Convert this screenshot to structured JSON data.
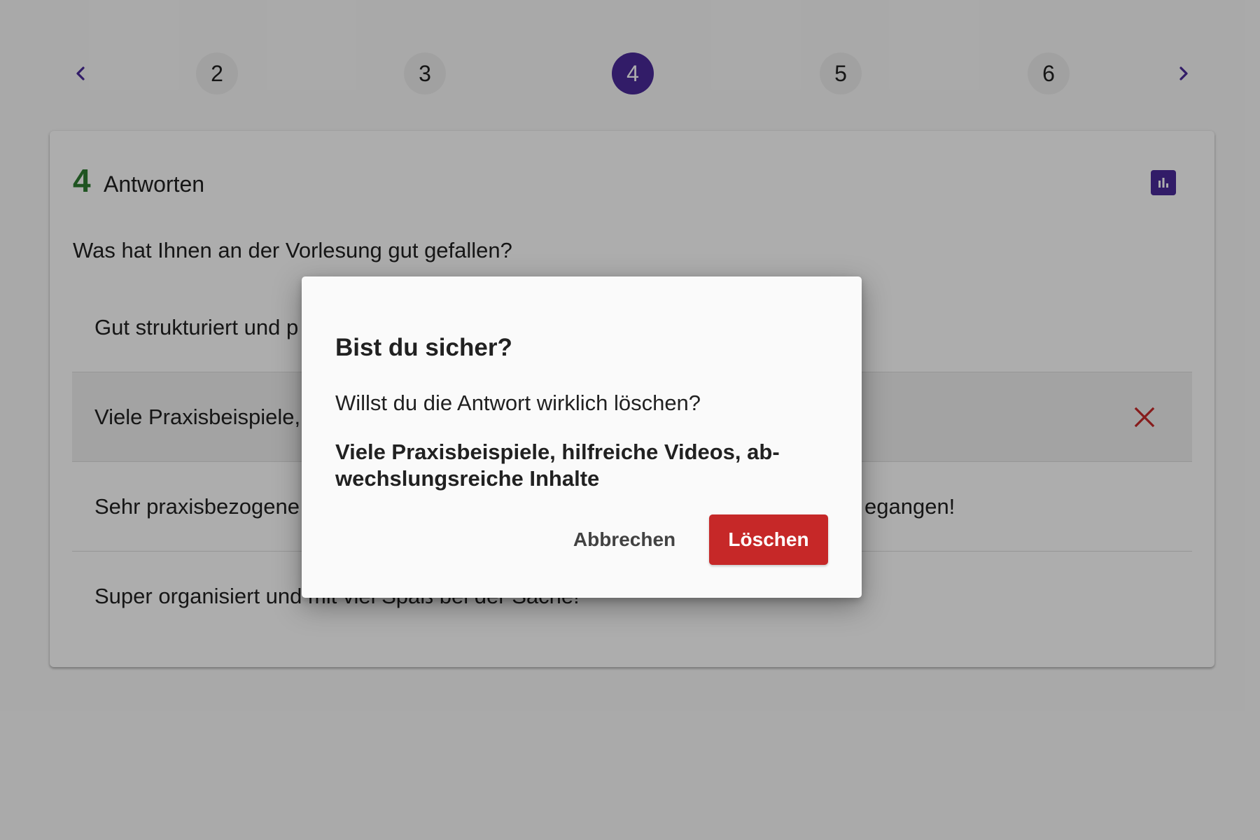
{
  "pagination": {
    "prev_icon": "chevron-left-icon",
    "next_icon": "chevron-right-icon",
    "pages": [
      "2",
      "3",
      "4",
      "5",
      "6"
    ],
    "current": "4",
    "accent_color": "#4a2a9a"
  },
  "card": {
    "count": "4",
    "count_label": "Antworten",
    "chart_icon": "bar-chart-icon",
    "question": "Was hat Ihnen an der Vorlesung gut gefallen?",
    "answers": [
      "Gut strukturiert und p",
      "Viele Praxisbeispiele,",
      "Sehr praxisbezogene",
      "Super organisiert und mit viel Spaß bei der Sache!"
    ],
    "answer_3_tail": "egangen!",
    "delete_icon": "close-icon",
    "delete_color": "#c62828"
  },
  "dialog": {
    "title": "Bist du sicher?",
    "message": "Willst du die Antwort wirklich löschen?",
    "answer_text": "Viele Praxisbeispiele, hilfreiche Videos, ab­wechslungsreiche Inhalte",
    "cancel_label": "Abbrechen",
    "delete_label": "Löschen"
  }
}
